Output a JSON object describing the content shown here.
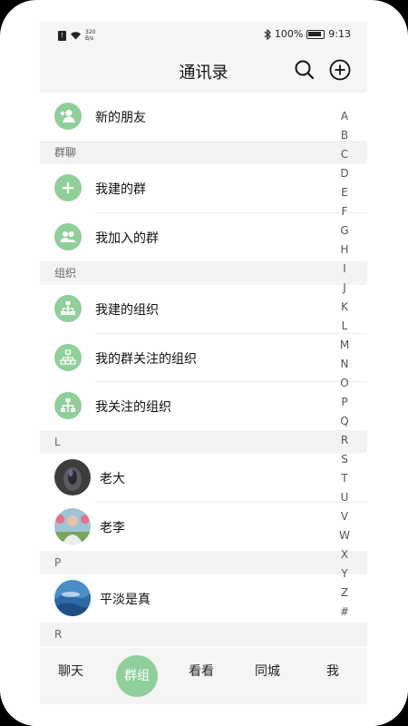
{
  "status": {
    "speed_value": "320",
    "speed_unit": "B/s",
    "battery": "100%",
    "time": "9:13"
  },
  "header": {
    "title": "通讯录"
  },
  "rows": {
    "new_friends": "新的朋友",
    "my_groups": "我建的群",
    "joined_groups": "我加入的群",
    "my_orgs": "我建的组织",
    "group_followed_orgs": "我的群关注的组织",
    "followed_orgs": "我关注的组织",
    "laoda": "老大",
    "laoli": "老李",
    "pingdan": "平淡是真"
  },
  "sections": {
    "groups": "群聊",
    "orgs": "组织",
    "L": "L",
    "P": "P",
    "R": "R"
  },
  "index": [
    "A",
    "B",
    "C",
    "D",
    "E",
    "F",
    "G",
    "H",
    "I",
    "J",
    "K",
    "L",
    "M",
    "N",
    "O",
    "P",
    "Q",
    "R",
    "S",
    "T",
    "U",
    "V",
    "W",
    "X",
    "Y",
    "Z",
    "#"
  ],
  "nav": {
    "chat": "聊天",
    "group": "群组",
    "watch": "看看",
    "local": "同城",
    "me": "我"
  },
  "colors": {
    "accent": "#8fcf9a",
    "header_bg": "#f5f5f5"
  }
}
